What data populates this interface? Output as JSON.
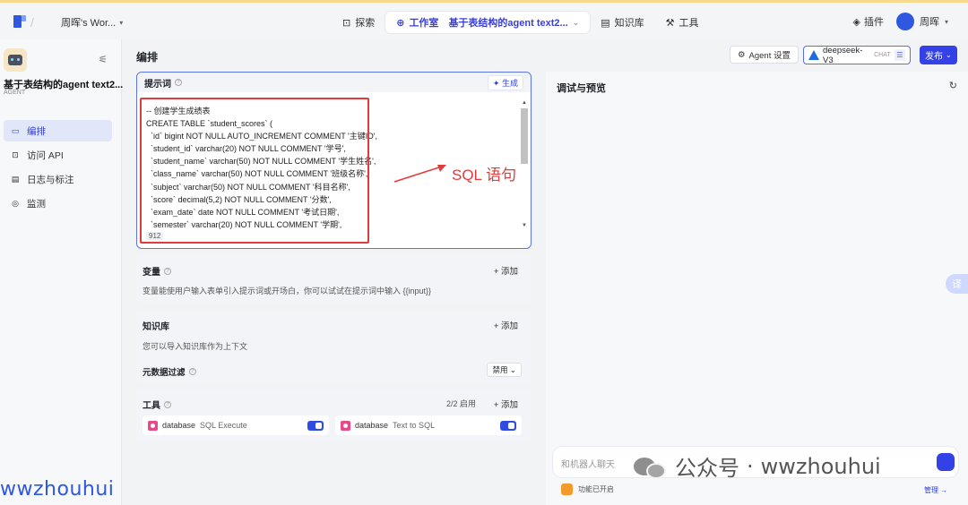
{
  "topbar": {
    "workspace": "周晖's Wor...",
    "nav": {
      "explore": "探索",
      "studio": "工作室",
      "agent_name": "基于表结构的agent text2...",
      "knowledge": "知识库",
      "tools": "工具"
    },
    "plugins": "插件",
    "user": "周晖"
  },
  "sidebar": {
    "agent_title": "基于表结构的agent text2...",
    "agent_type": "AGENT",
    "items": [
      {
        "label": "编排",
        "icon": "layout-icon"
      },
      {
        "label": "访问 API",
        "icon": "api-icon"
      },
      {
        "label": "日志与标注",
        "icon": "log-icon"
      },
      {
        "label": "监测",
        "icon": "monitor-icon"
      }
    ]
  },
  "main": {
    "title": "编排",
    "agent_settings": "Agent 设置",
    "model": "deepseek-V3",
    "model_tag": "CHAT",
    "publish": "发布"
  },
  "prompt": {
    "title": "提示词",
    "generate": "生成",
    "code": "-- 创建学生成绩表\nCREATE TABLE `student_scores` (\n  `id` bigint NOT NULL AUTO_INCREMENT COMMENT '主键ID',\n  `student_id` varchar(20) NOT NULL COMMENT '学号',\n  `student_name` varchar(50) NOT NULL COMMENT '学生姓名',\n  `class_name` varchar(50) NOT NULL COMMENT '班级名称',\n  `subject` varchar(50) NOT NULL COMMENT '科目名称',\n  `score` decimal(5,2) NOT NULL COMMENT '分数',\n  `exam_date` date NOT NULL COMMENT '考试日期',\n  `semester` varchar(20) NOT NULL COMMENT '学期',",
    "char_count": "912",
    "annotation": "SQL 语句"
  },
  "variables": {
    "title": "变量",
    "add": "+ 添加",
    "desc": "变量能使用户输入表单引入提示词或开场白，你可以试试在提示词中输入 {{input}}"
  },
  "knowledge": {
    "title": "知识库",
    "add": "+ 添加",
    "desc": "您可以导入知识库作为上下文",
    "filter_label": "元数据过滤",
    "filter_value": "禁用"
  },
  "tools": {
    "title": "工具",
    "count": "2/2 启用",
    "add": "+ 添加",
    "items": [
      {
        "name": "database",
        "sub": "SQL Execute"
      },
      {
        "name": "database",
        "sub": "Text to SQL"
      }
    ]
  },
  "preview": {
    "title": "调试与预览",
    "placeholder": "和机器人聊天",
    "status": "功能已开启",
    "manage": "管理 →"
  },
  "watermark": {
    "left": "wwzhouhui",
    "right_brand": "公众号",
    "right_sep": "·",
    "right_name": "wwzhouhui"
  },
  "translate": "译"
}
